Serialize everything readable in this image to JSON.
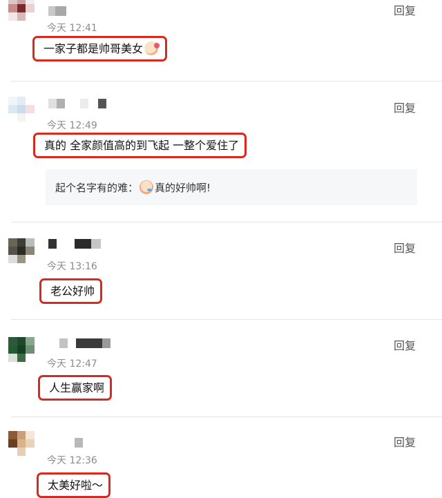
{
  "ui": {
    "reply_label": "回复"
  },
  "comments": [
    {
      "time": "今天 12:41",
      "text": "一家子都是帅哥美女",
      "emoji": "blushing-face-emoji"
    },
    {
      "time": "今天 12:49",
      "text": "真的 全家颜值高的到飞起 一整个爱住了",
      "sub_reply": {
        "prefix": "起个名字有的难：",
        "emoji": "crying-face-emoji",
        "suffix": "真的好帅啊!"
      }
    },
    {
      "time": "今天 13:16",
      "text": "老公好帅"
    },
    {
      "time": "今天 12:47",
      "text": "人生赢家啊"
    },
    {
      "time": "今天 12:36",
      "text": "太美好啦～"
    }
  ],
  "colors": {
    "highlight_border": "#d62a1e",
    "time_text": "#8c8c8c",
    "divider": "#e6e6e6",
    "sub_reply_bg": "#f6f7f9"
  }
}
